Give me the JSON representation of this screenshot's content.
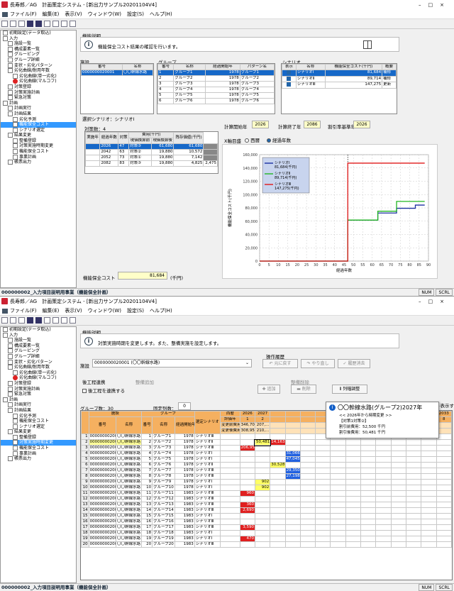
{
  "w1": {
    "title": "長寿郎／AG　計画策定システム - [新出力サンプル20201104V4]",
    "menu": [
      "ファイル(F)",
      "編集(E)",
      "表示(V)",
      "ウィンドウ(W)",
      "設定(S)",
      "ヘルプ(H)"
    ],
    "tree": [
      {
        "t": "初期設定(データ取込)",
        "l": 0
      },
      {
        "t": "入力",
        "l": 0
      },
      {
        "t": "施設一覧",
        "l": 1
      },
      {
        "t": "構成要素一覧",
        "l": 1
      },
      {
        "t": "グルーピング",
        "l": 1
      },
      {
        "t": "グループ詳細",
        "l": 1
      },
      {
        "t": "変状・劣化パターン",
        "l": 1
      },
      {
        "t": "劣化曲線/耐用年数",
        "l": 1
      },
      {
        "t": "劣化曲線(単一劣化)",
        "l": 2
      },
      {
        "t": "劣化曲線(マルコフ)",
        "l": 2,
        "red": true
      },
      {
        "t": "対策登録",
        "l": 1
      },
      {
        "t": "対策実施計画",
        "l": 1
      },
      {
        "t": "緊急対策",
        "l": 1
      },
      {
        "t": "計画",
        "l": 0
      },
      {
        "t": "計画実行",
        "l": 1
      },
      {
        "t": "計画結果",
        "l": 1
      },
      {
        "t": "劣化予測",
        "l": 2
      },
      {
        "t": "機能保全コスト",
        "l": 2,
        "sel": true
      },
      {
        "t": "シナリオ選定",
        "l": 2
      },
      {
        "t": "結果変更",
        "l": 1
      },
      {
        "t": "整備登録",
        "l": 2
      },
      {
        "t": "対策実施時期変更",
        "l": 2
      },
      {
        "t": "機能保全コスト",
        "l": 2
      },
      {
        "t": "事業計画",
        "l": 2
      },
      {
        "t": "帳票出力",
        "l": 1
      }
    ],
    "section": "機能説明",
    "info": "機能保全コスト結果の確認を行います。",
    "facility": {
      "label": "施設",
      "cols": [
        "番号",
        "名称"
      ],
      "rows": [
        [
          "0000000020001",
          "〇〇幹線水路"
        ]
      ]
    },
    "group": {
      "label": "グループ",
      "cols": [
        "番号",
        "名称",
        "経過開始年",
        "パターン名"
      ],
      "rows": [
        [
          "1",
          "グループ1",
          "1978",
          "グループ1"
        ],
        [
          "2",
          "グループ2",
          "1978",
          "グループ2"
        ],
        [
          "3",
          "グループ3",
          "1978",
          "グループ3"
        ],
        [
          "4",
          "グループ4",
          "1978",
          "グループ4"
        ],
        [
          "5",
          "グループ5",
          "1978",
          "グループ5"
        ],
        [
          "6",
          "グループ6",
          "1978",
          "グループ6"
        ]
      ]
    },
    "scenario": {
      "label": "シナリオ",
      "cols": [
        "表示",
        "名称",
        "機能保全コスト(千円)",
        "概要"
      ],
      "rows": [
        [
          "シナリオⅠ",
          "81,684",
          "補修"
        ],
        [
          "シナリオⅡ",
          "89,714",
          "補修"
        ],
        [
          "シナリオⅢ",
          "147,275",
          "更新"
        ]
      ]
    },
    "selScenario": "選択シナリオ：シナリオⅠ",
    "count": "対策数：4",
    "measureCols": [
      "実施年",
      "経過年数",
      "対策",
      "費用(千円)",
      "現価換算前",
      "現価換算後",
      "残存価値(千円)"
    ],
    "measures": [
      [
        "2026",
        "47",
        "対策③",
        "61,680",
        "61,680",
        ""
      ],
      [
        "2042",
        "63",
        "対策②",
        "19,880",
        "10,572",
        ""
      ],
      [
        "2052",
        "73",
        "対策①",
        "19,880",
        "7,142",
        ""
      ],
      [
        "2082",
        "83",
        "対策③",
        "19,880",
        "4,825",
        "2,475"
      ]
    ],
    "costLabel": "機能保全コスト",
    "costVal": "81,684",
    "costUnit": "(千円)",
    "years": {
      "startL": "計算開始年",
      "start": "2026",
      "endL": "計算終了年",
      "end": "2086",
      "rateL": "割引率基準年",
      "rate": "2026"
    },
    "axisMode": {
      "label": "X軸目盛",
      "opt1": "西暦",
      "opt2": "経過年数"
    },
    "status": "000000002_入力項目説明用事業（機能保全計画）",
    "ind1": "NUM",
    "ind2": "SCRL"
  },
  "chart_data": {
    "type": "line",
    "xlabel": "経過年数",
    "ylabel": "機能保全コスト(千円)",
    "xlim": [
      0,
      90
    ],
    "ylim": [
      0,
      160000
    ],
    "xticks": [
      0,
      5,
      10,
      15,
      20,
      25,
      30,
      35,
      40,
      45,
      50,
      55,
      60,
      65,
      70,
      75,
      80,
      85,
      90
    ],
    "yticks": [
      0,
      20000,
      40000,
      60000,
      80000,
      100000,
      120000,
      140000,
      160000
    ],
    "ytick_labels": [
      "0",
      "20,000",
      "40,000",
      "60,000",
      "80,000",
      "100,000",
      "120,000",
      "140,000",
      "160,000"
    ],
    "series": [
      {
        "name": "シナリオⅠ",
        "legend": "シナリオⅠ 81,684(千円)",
        "color": "#1a2fa0",
        "x": [
          0,
          47,
          47,
          63,
          63,
          73,
          73,
          83,
          83,
          88
        ],
        "y": [
          0,
          0,
          61680,
          61680,
          72252,
          72252,
          79394,
          79394,
          84219,
          84219
        ]
      },
      {
        "name": "シナリオⅡ",
        "legend": "シナリオⅡ 89,714(千円)",
        "color": "#22b522",
        "x": [
          0,
          47,
          47,
          63,
          63,
          73,
          73,
          88
        ],
        "y": [
          0,
          0,
          61680,
          61680,
          75000,
          75000,
          89714,
          89714
        ]
      },
      {
        "name": "シナリオⅢ",
        "legend": "シナリオⅢ 147,275(千円)",
        "color": "#e01818",
        "x": [
          0,
          47,
          47,
          88
        ],
        "y": [
          0,
          0,
          147275,
          147275
        ]
      }
    ],
    "legend": "top-left",
    "grid": true
  },
  "w2": {
    "title": "長寿郎／AG　計画策定システム - [新出力サンプル20201104V4]",
    "menu": [
      "ファイル(F)",
      "編集(E)",
      "表示(V)",
      "ウィンドウ(W)",
      "設定(S)",
      "ヘルプ(H)"
    ],
    "tree": [
      {
        "t": "初期設定(データ取込)",
        "l": 0
      },
      {
        "t": "入力",
        "l": 0
      },
      {
        "t": "施設一覧",
        "l": 1
      },
      {
        "t": "構成要素一覧",
        "l": 1
      },
      {
        "t": "グルーピング",
        "l": 1
      },
      {
        "t": "グループ詳細",
        "l": 1
      },
      {
        "t": "変状・劣化パターン",
        "l": 1
      },
      {
        "t": "劣化曲線/耐用年数",
        "l": 1
      },
      {
        "t": "劣化曲線(単一劣化)",
        "l": 2
      },
      {
        "t": "劣化曲線(マルコフ)",
        "l": 2,
        "red": true
      },
      {
        "t": "対策登録",
        "l": 1
      },
      {
        "t": "対策実施計画",
        "l": 1
      },
      {
        "t": "緊急対策",
        "l": 1
      },
      {
        "t": "計画",
        "l": 0
      },
      {
        "t": "計画実行",
        "l": 1
      },
      {
        "t": "計画結果",
        "l": 1
      },
      {
        "t": "劣化予測",
        "l": 2
      },
      {
        "t": "機能保全コスト",
        "l": 2
      },
      {
        "t": "シナリオ選定",
        "l": 2
      },
      {
        "t": "結果変更",
        "l": 1
      },
      {
        "t": "整備登録",
        "l": 2
      },
      {
        "t": "対策実施時期変更",
        "l": 2,
        "sel": true
      },
      {
        "t": "機能保全コスト",
        "l": 2
      },
      {
        "t": "事業計画",
        "l": 2
      },
      {
        "t": "帳票出力",
        "l": 1
      }
    ],
    "section": "機能説明",
    "info": "対策実施時期を変更します。また、整備実施を設定します。",
    "opHist": "操作履歴",
    "btnUndo": "元に戻す",
    "btnRedo": "やり直し",
    "btnClear": "履歴消去",
    "facLabel": "施設",
    "facSelect": "0000000020001 (〇〇幹線水路)",
    "linkLabel": "後工程連携",
    "linkChk": "後工程を連携する",
    "addLabel": "整備追加",
    "addBtn": "追加",
    "delLabel": "整備削除",
    "delBtn": "削除",
    "colAdj": "列幅調整",
    "groupCount": "グループ数：30",
    "fixLabel": "固定列数：",
    "fixVal": "0",
    "showLabel": "ト表示する",
    "tip": {
      "title": "〇〇幹線水路(グループ2)2027年",
      "sub": "<< 2026年から時期変更 >>",
      "l1": "【対策1対策②】",
      "l2": "割引前費用：52,500 千円",
      "l3": "割引後費用：50,481 千円"
    },
    "hdr": {
      "facility": "施設",
      "group": "グループ",
      "num": "番号",
      "name": "名称",
      "gnum": "番号",
      "gname": "名称",
      "start": "経過開始年",
      "scen": "選定シナリオ",
      "era": "西暦",
      "elapsed": "評価年",
      "before": "変更前費用",
      "after": "変更後費用"
    },
    "yearCols": [
      "2026",
      "2027",
      "",
      "",
      "",
      "",
      "",
      "",
      "",
      "",
      "",
      "",
      "",
      "2033"
    ],
    "elapsedCols": [
      "1",
      "2",
      "",
      "",
      "",
      "",
      "",
      "",
      "",
      "",
      "",
      "",
      "",
      "8"
    ],
    "beforeCosts": [
      "346,703",
      "207,..."
    ],
    "afterCosts": [
      "308,950",
      "210,..."
    ],
    "rows": [
      [
        "1",
        "0000000020001",
        "〇〇幹線水路",
        "1",
        "グループ1",
        "1978",
        "シナリオⅢ"
      ],
      [
        "2",
        "0000000020001",
        "〇〇幹線水路",
        "2",
        "グループ2",
        "1978",
        "シナリオⅡ"
      ],
      [
        "3",
        "0000000020001",
        "〇〇幹線水路",
        "3",
        "グループ3",
        "1978",
        "シナリオⅢ"
      ],
      [
        "4",
        "0000000020001",
        "〇〇幹線水路",
        "4",
        "グループ4",
        "1978",
        "シナリオⅠ"
      ],
      [
        "5",
        "0000000020001",
        "〇〇幹線水路",
        "5",
        "グループ5",
        "1978",
        "シナリオⅠ"
      ],
      [
        "6",
        "0000000020001",
        "〇〇幹線水路",
        "6",
        "グループ6",
        "1978",
        "シナリオⅡ"
      ],
      [
        "7",
        "0000000020001",
        "〇〇幹線水路",
        "7",
        "グループ7",
        "1978",
        "シナリオⅢ"
      ],
      [
        "8",
        "0000000020001",
        "〇〇幹線水路",
        "8",
        "グループ8",
        "1978",
        "シナリオⅢ"
      ],
      [
        "9",
        "0000000020001",
        "〇〇幹線水路",
        "9",
        "グループ9",
        "1978",
        "シナリオⅠ"
      ],
      [
        "10",
        "0000000020001",
        "〇〇幹線水路",
        "10",
        "グループ10",
        "1978",
        "シナリオⅠ"
      ],
      [
        "11",
        "0000000020001",
        "〇〇幹線水路",
        "11",
        "グループ11",
        "1983",
        "シナリオⅢ"
      ],
      [
        "12",
        "0000000020001",
        "〇〇幹線水路",
        "12",
        "グループ12",
        "1983",
        "シナリオⅢ"
      ],
      [
        "13",
        "0000000020001",
        "〇〇幹線水路",
        "13",
        "グループ13",
        "1983",
        "シナリオⅢ"
      ],
      [
        "14",
        "0000000020001",
        "〇〇幹線水路",
        "14",
        "グループ14",
        "1983",
        "シナリオⅢ"
      ],
      [
        "15",
        "0000000020001",
        "〇〇幹線水路",
        "15",
        "グループ15",
        "1983",
        "シナリオⅠ"
      ],
      [
        "16",
        "0000000020001",
        "〇〇幹線水路",
        "16",
        "グループ16",
        "1983",
        "シナリオⅢ"
      ],
      [
        "17",
        "0000000020001",
        "〇〇幹線水路",
        "17",
        "グループ17",
        "1983",
        "シナリオⅢ"
      ],
      [
        "18",
        "0000000020001",
        "〇〇幹線水路",
        "18",
        "グループ18",
        "1983",
        "シナリオⅠ"
      ],
      [
        "19",
        "0000000020001",
        "〇〇幹線水路",
        "19",
        "グループ19",
        "1983",
        "シナリオⅠ"
      ],
      [
        "20",
        "0000000020001",
        "〇〇幹線水路",
        "20",
        "グループ20",
        "1983",
        "シナリオⅢ"
      ]
    ],
    "cells": [
      {
        "r": 1,
        "c": 2,
        "v": "14,163",
        "col": "#e02020"
      },
      {
        "r": 1,
        "c": 1,
        "v": "50,481",
        "col": "#ffff66",
        "sel": true
      },
      {
        "r": 2,
        "c": 0,
        "v": "206,950",
        "col": "#e02020"
      },
      {
        "r": 3,
        "c": 3,
        "v": "31,066",
        "col": "#2060e0"
      },
      {
        "r": 4,
        "c": 3,
        "v": "47,045",
        "col": "#2060e0"
      },
      {
        "r": 5,
        "c": 2,
        "v": "30,528",
        "col": "#ffff66"
      },
      {
        "r": 6,
        "c": 3,
        "v": "29,350",
        "col": "#2060e0"
      },
      {
        "r": 7,
        "c": 3,
        "v": "27,198",
        "col": "#2060e0"
      },
      {
        "r": 8,
        "c": 1,
        "v": "902",
        "col": "#ffff66"
      },
      {
        "r": 9,
        "c": 1,
        "v": "902",
        "col": "#ffff66"
      },
      {
        "r": 10,
        "c": 0,
        "v": "960",
        "col": "#e02020"
      },
      {
        "r": 12,
        "c": 0,
        "v": "360",
        "col": "#e02020"
      },
      {
        "r": 13,
        "c": 0,
        "v": "2,690",
        "col": "#e02020"
      },
      {
        "r": 16,
        "c": 0,
        "v": "3,590",
        "col": "#e02020"
      },
      {
        "r": 18,
        "c": 0,
        "v": "470",
        "col": "#e02020"
      }
    ],
    "status": "000000002_入力項目説明用事業（機能保全計画）",
    "ind1": "NUM",
    "ind2": "SCRL"
  }
}
